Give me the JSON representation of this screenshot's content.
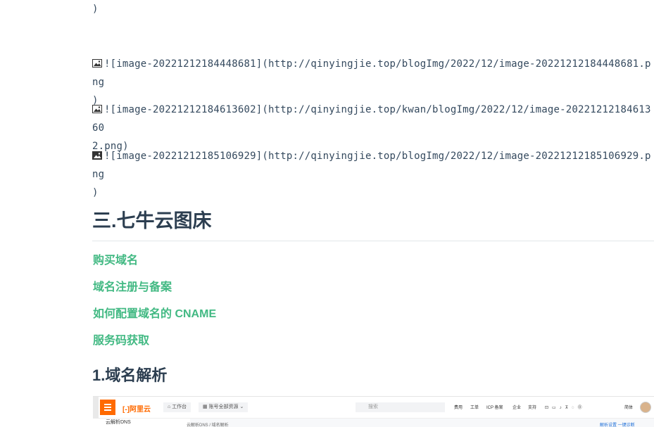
{
  "markdown_lines": {
    "trailing_paren": ")",
    "img1_alt": "![image-20221212184448681](http://qinyingjie.top/blogImg/2022/12/image-20221212184448681.png",
    "img1_close": ")",
    "img2_alt": "![image-20221212184613602](http://qinyingjie.top/kwan/blogImg/2022/12/image-2022121218461360",
    "img2_close": "2.png)",
    "img3_alt": "![image-20221212185106929](http://qinyingjie.top/blogImg/2022/12/image-20221212185106929.png",
    "img3_close": ")"
  },
  "section": {
    "heading": "三.七牛云图床",
    "links": [
      "购买域名",
      "域名注册与备案",
      "如何配置域名的 CNAME",
      "服务码获取"
    ],
    "subheading": "1.域名解析"
  },
  "screenshot": {
    "logo": "阿里云",
    "tab_workbench": "工作台",
    "tab_resources": "账号全部资源",
    "search_placeholder": "搜索",
    "nav": [
      "费用",
      "工单",
      "ICP 备案",
      "企业",
      "支持"
    ],
    "nav_extra": "简体",
    "side_title": "云解析DNS",
    "breadcrumb": "云解析DNS / 域名解析",
    "right_links": "解析设置  一键诊断"
  },
  "colors": {
    "link": "#42b983",
    "heading": "#2c3e50",
    "accent": "#ff6a00"
  },
  "icons": [
    "broken-image-icon",
    "menu-icon",
    "search-icon",
    "avatar"
  ]
}
